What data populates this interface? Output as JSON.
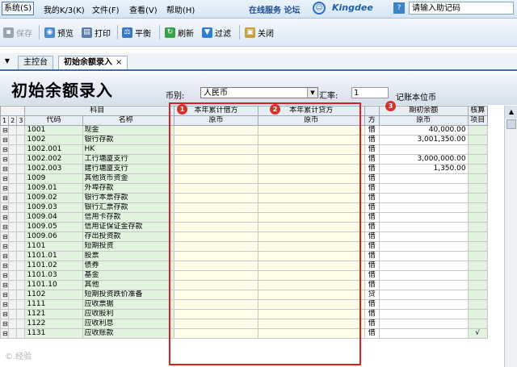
{
  "menu": {
    "items": [
      "系统(S)",
      "我的K/3(K)",
      "文件(F)",
      "查看(V)",
      "帮助(H)"
    ],
    "links": "在线服务 论坛",
    "brand": "Kingdee",
    "help_value": "请输入助记码"
  },
  "toolbar": {
    "save": "保存",
    "preview": "预览",
    "print": "打印",
    "balance": "平衡",
    "refresh": "刷新",
    "filter": "过滤",
    "close": "关闭"
  },
  "tabs": {
    "home": "主控台",
    "current": "初始余额录入",
    "close_glyph": "×"
  },
  "form": {
    "title": "初始余额录入",
    "currency_label": "币别:",
    "currency": "人民币",
    "rate_label": "汇率:",
    "rate": "1",
    "note": "记账本位币"
  },
  "columns": {
    "levels": [
      "1",
      "2",
      "3"
    ],
    "subject": "科目",
    "code": "代码",
    "name": "名称",
    "debit": "本年累计借方",
    "credit": "本年累计贷方",
    "orig": "原币",
    "dir": "方",
    "opening": "期初余额",
    "check": "核算",
    "check2": "项目"
  },
  "badges": [
    "1",
    "2",
    "3"
  ],
  "rows": [
    {
      "code": "1001",
      "name": "现金",
      "dir": "借",
      "amount": "40,000.00",
      "sign": "⊟",
      "chk": ""
    },
    {
      "code": "1002",
      "name": "银行存款",
      "dir": "借",
      "amount": "3,001,350.00",
      "sign": "⊟",
      "chk": ""
    },
    {
      "code": "1002.001",
      "name": "HK",
      "dir": "借",
      "amount": "",
      "sign": "⊟",
      "chk": ""
    },
    {
      "code": "1002.002",
      "name": "工行塘厦支行",
      "dir": "借",
      "amount": "3,000,000.00",
      "sign": "⊟",
      "chk": ""
    },
    {
      "code": "1002.003",
      "name": "建行塘厦支行",
      "dir": "借",
      "amount": "1,350.00",
      "sign": "⊟",
      "chk": ""
    },
    {
      "code": "1009",
      "name": "其他货币资金",
      "dir": "借",
      "amount": "",
      "sign": "⊟",
      "chk": ""
    },
    {
      "code": "1009.01",
      "name": "外埠存款",
      "dir": "借",
      "amount": "",
      "sign": "⊟",
      "chk": ""
    },
    {
      "code": "1009.02",
      "name": "银行本票存款",
      "dir": "借",
      "amount": "",
      "sign": "⊟",
      "chk": ""
    },
    {
      "code": "1009.03",
      "name": "银行汇票存款",
      "dir": "借",
      "amount": "",
      "sign": "⊟",
      "chk": ""
    },
    {
      "code": "1009.04",
      "name": "信用卡存款",
      "dir": "借",
      "amount": "",
      "sign": "⊟",
      "chk": ""
    },
    {
      "code": "1009.05",
      "name": "信用证保证金存款",
      "dir": "借",
      "amount": "",
      "sign": "⊟",
      "chk": ""
    },
    {
      "code": "1009.06",
      "name": "存出投资款",
      "dir": "借",
      "amount": "",
      "sign": "⊟",
      "chk": ""
    },
    {
      "code": "1101",
      "name": "短期投资",
      "dir": "借",
      "amount": "",
      "sign": "⊟",
      "chk": ""
    },
    {
      "code": "1101.01",
      "name": "股票",
      "dir": "借",
      "amount": "",
      "sign": "⊟",
      "chk": ""
    },
    {
      "code": "1101.02",
      "name": "债券",
      "dir": "借",
      "amount": "",
      "sign": "⊟",
      "chk": ""
    },
    {
      "code": "1101.03",
      "name": "基金",
      "dir": "借",
      "amount": "",
      "sign": "⊟",
      "chk": ""
    },
    {
      "code": "1101.10",
      "name": "其他",
      "dir": "借",
      "amount": "",
      "sign": "⊟",
      "chk": ""
    },
    {
      "code": "1102",
      "name": "短期投资跌价准备",
      "dir": "贷",
      "amount": "",
      "sign": "⊟",
      "chk": ""
    },
    {
      "code": "1111",
      "name": "应收票据",
      "dir": "借",
      "amount": "",
      "sign": "⊟",
      "chk": ""
    },
    {
      "code": "1121",
      "name": "应收股利",
      "dir": "借",
      "amount": "",
      "sign": "⊟",
      "chk": ""
    },
    {
      "code": "1122",
      "name": "应收利息",
      "dir": "借",
      "amount": "",
      "sign": "⊟",
      "chk": ""
    },
    {
      "code": "1131",
      "name": "应收账款",
      "dir": "借",
      "amount": "",
      "sign": "⊟",
      "chk": "√"
    }
  ],
  "watermark": "© 经验"
}
